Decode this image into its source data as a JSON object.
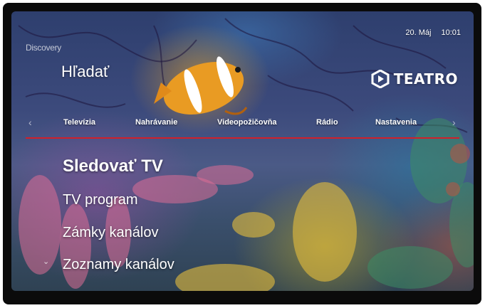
{
  "brand": {
    "channel_logo": "Discovery"
  },
  "header": {
    "date": "20. Máj",
    "time": "10:01",
    "search_label": "Hľadať",
    "logo_text": "TEATRO"
  },
  "nav": {
    "tabs": [
      {
        "label": "Televízia"
      },
      {
        "label": "Nahrávanie"
      },
      {
        "label": "Videopožičovňa"
      },
      {
        "label": "Rádio"
      },
      {
        "label": "Nastavenia"
      }
    ],
    "left_arrow": "‹",
    "right_arrow": "›"
  },
  "menu": {
    "items": [
      {
        "label": "Sledovať TV",
        "active": true
      },
      {
        "label": "TV program",
        "active": false
      },
      {
        "label": "Zámky kanálov",
        "active": false
      },
      {
        "label": "Zoznamy kanálov",
        "active": false
      }
    ],
    "more_indicator": "⌄"
  },
  "colors": {
    "accent": "#d0202a",
    "text": "#ffffff",
    "bezel": "#0b0b0b"
  }
}
